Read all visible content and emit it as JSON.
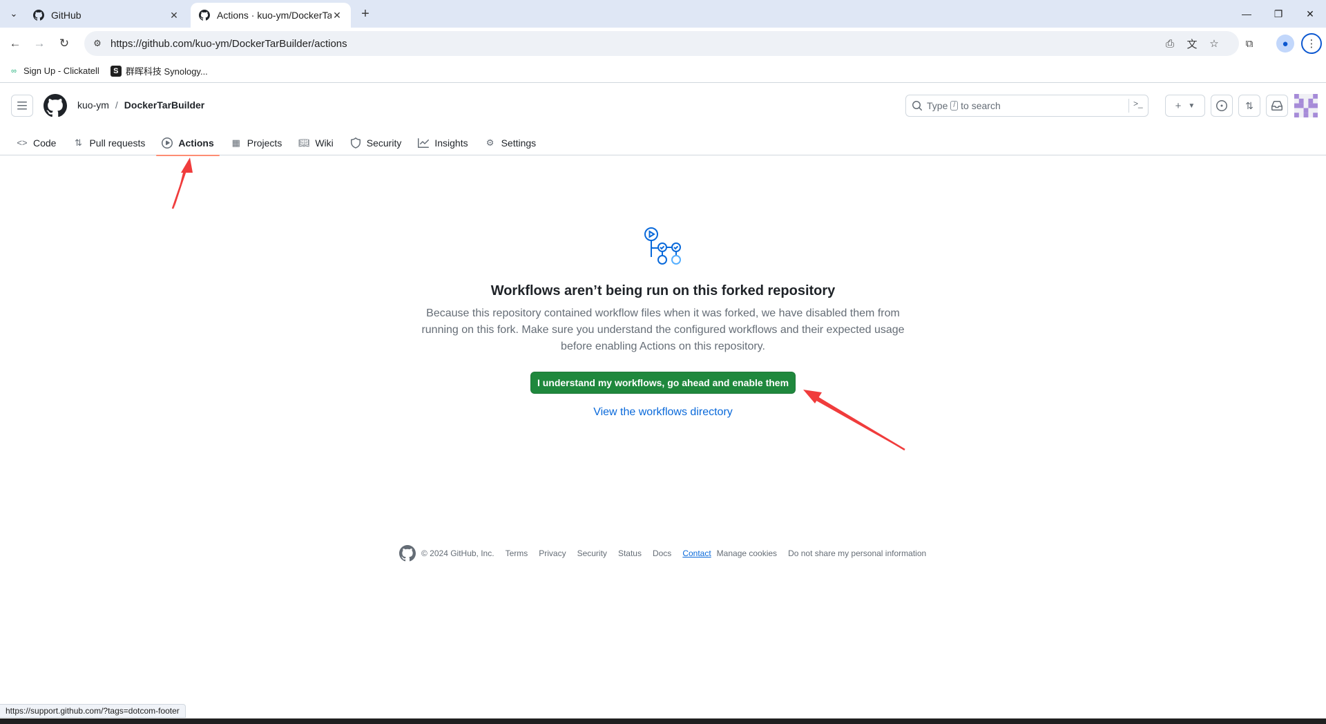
{
  "browser": {
    "tabs": [
      {
        "title": "GitHub",
        "active": false
      },
      {
        "title": "Actions · kuo-ym/DockerTarBuilder",
        "active": true
      }
    ],
    "url": "https://github.com/kuo-ym/DockerTarBuilder/actions",
    "bookmarks": [
      {
        "label": "Sign Up - Clickatell"
      },
      {
        "label": "群晖科技 Synology..."
      }
    ],
    "status_url": "https://support.github.com/?tags=dotcom-footer"
  },
  "header": {
    "owner": "kuo-ym",
    "separator": "/",
    "repo": "DockerTarBuilder",
    "search_prefix": "Type",
    "search_key": "/",
    "search_suffix": "to search"
  },
  "repo_nav": [
    {
      "label": "Code",
      "icon": "code-icon"
    },
    {
      "label": "Pull requests",
      "icon": "git-pull-request-icon"
    },
    {
      "label": "Actions",
      "icon": "play-icon",
      "active": true
    },
    {
      "label": "Projects",
      "icon": "table-icon"
    },
    {
      "label": "Wiki",
      "icon": "book-icon"
    },
    {
      "label": "Security",
      "icon": "shield-icon"
    },
    {
      "label": "Insights",
      "icon": "graph-icon"
    },
    {
      "label": "Settings",
      "icon": "gear-icon"
    }
  ],
  "blankslate": {
    "title": "Workflows aren’t being run on this forked repository",
    "description": "Because this repository contained workflow files when it was forked, we have disabled them from running on this fork. Make sure you understand the configured workflows and their expected usage before enabling Actions on this repository.",
    "enable_button": "I understand my workflows, go ahead and enable them",
    "workflows_link": "View the workflows directory"
  },
  "footer": {
    "copyright": "© 2024 GitHub, Inc.",
    "links": [
      "Terms",
      "Privacy",
      "Security",
      "Status",
      "Docs",
      "Contact",
      "Manage cookies",
      "Do not share my personal information"
    ]
  },
  "colors": {
    "primary_button": "#1f883d",
    "link": "#0969da",
    "annotation_arrow": "#f03c3c",
    "active_tab_underline": "#fd8c73"
  }
}
